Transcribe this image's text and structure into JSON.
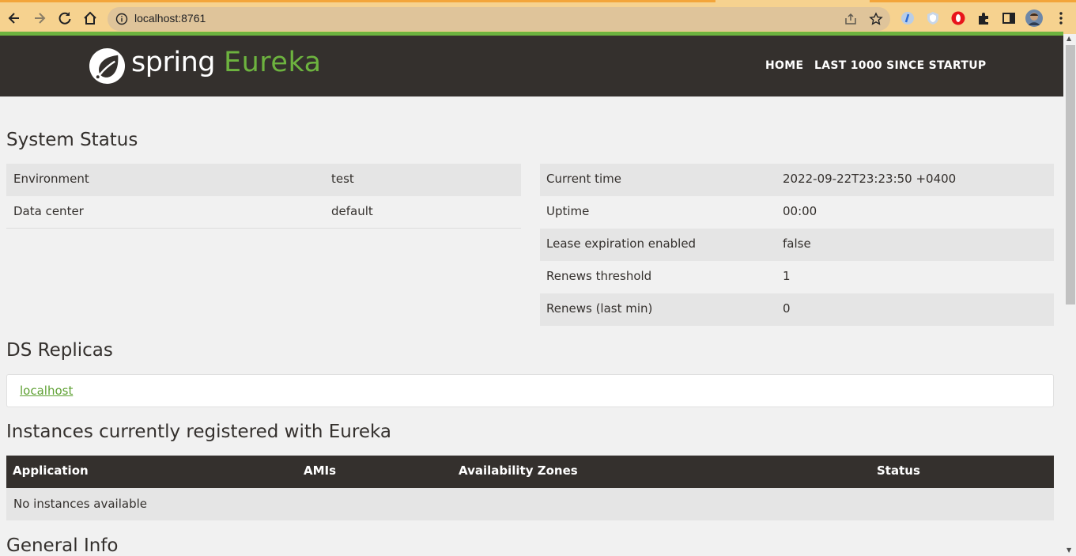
{
  "browser": {
    "url": "localhost:8761"
  },
  "header": {
    "logo_spring": "spring",
    "logo_eureka": "Eureka",
    "nav_home": "HOME",
    "nav_last": "LAST 1000 SINCE STARTUP"
  },
  "system_status": {
    "title": "System Status",
    "left": [
      {
        "label": "Environment",
        "value": "test"
      },
      {
        "label": "Data center",
        "value": "default"
      }
    ],
    "right": [
      {
        "label": "Current time",
        "value": "2022-09-22T23:23:50 +0400"
      },
      {
        "label": "Uptime",
        "value": "00:00"
      },
      {
        "label": "Lease expiration enabled",
        "value": "false"
      },
      {
        "label": "Renews threshold",
        "value": "1"
      },
      {
        "label": "Renews (last min)",
        "value": "0"
      }
    ]
  },
  "ds_replicas": {
    "title": "DS Replicas",
    "link": "localhost"
  },
  "instances": {
    "title": "Instances currently registered with Eureka",
    "columns": [
      "Application",
      "AMIs",
      "Availability Zones",
      "Status"
    ],
    "empty": "No instances available"
  },
  "general_info": {
    "title": "General Info"
  },
  "colors": {
    "accent": "#6db33f",
    "header_bg": "#34302d",
    "page_bg": "#f1f1f1"
  }
}
